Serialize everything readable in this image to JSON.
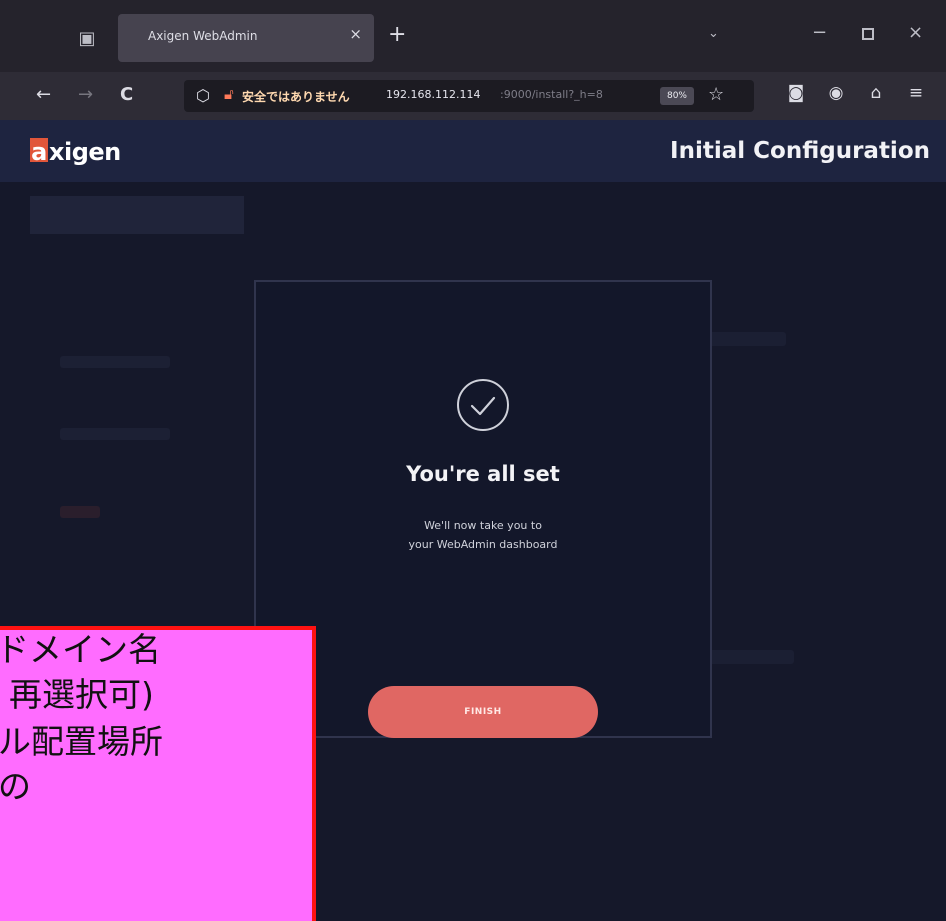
{
  "browser": {
    "tab_title": "Axigen WebAdmin",
    "tab_close": "×",
    "new_tab": "+",
    "tabs_menu": "⌄",
    "window": {
      "minimize": "−",
      "close": "×"
    },
    "nav": {
      "back": "←",
      "forward": "→",
      "reload": "C"
    },
    "url": {
      "insecure_label": "安全ではありません",
      "host": "192.168.112.114",
      "path": ":9000/install?_h=8",
      "zoom": "80%"
    },
    "icons": [
      "pocket-icon",
      "account-icon",
      "extensions-icon",
      "menu-icon"
    ]
  },
  "app": {
    "logo_mark": "a",
    "logo_rest": "xigen",
    "header_title": "Initial Configuration"
  },
  "modal": {
    "title": "You're all set",
    "message_line1": "We'll now take you to",
    "message_line2": "your WebAdmin dashboard",
    "finish_label": "FINISH"
  },
  "overlay_note": {
    "line1": "ドメイン名",
    "line2": "、再選択可)",
    "line3": "ル配置場所",
    "line4": "の"
  }
}
